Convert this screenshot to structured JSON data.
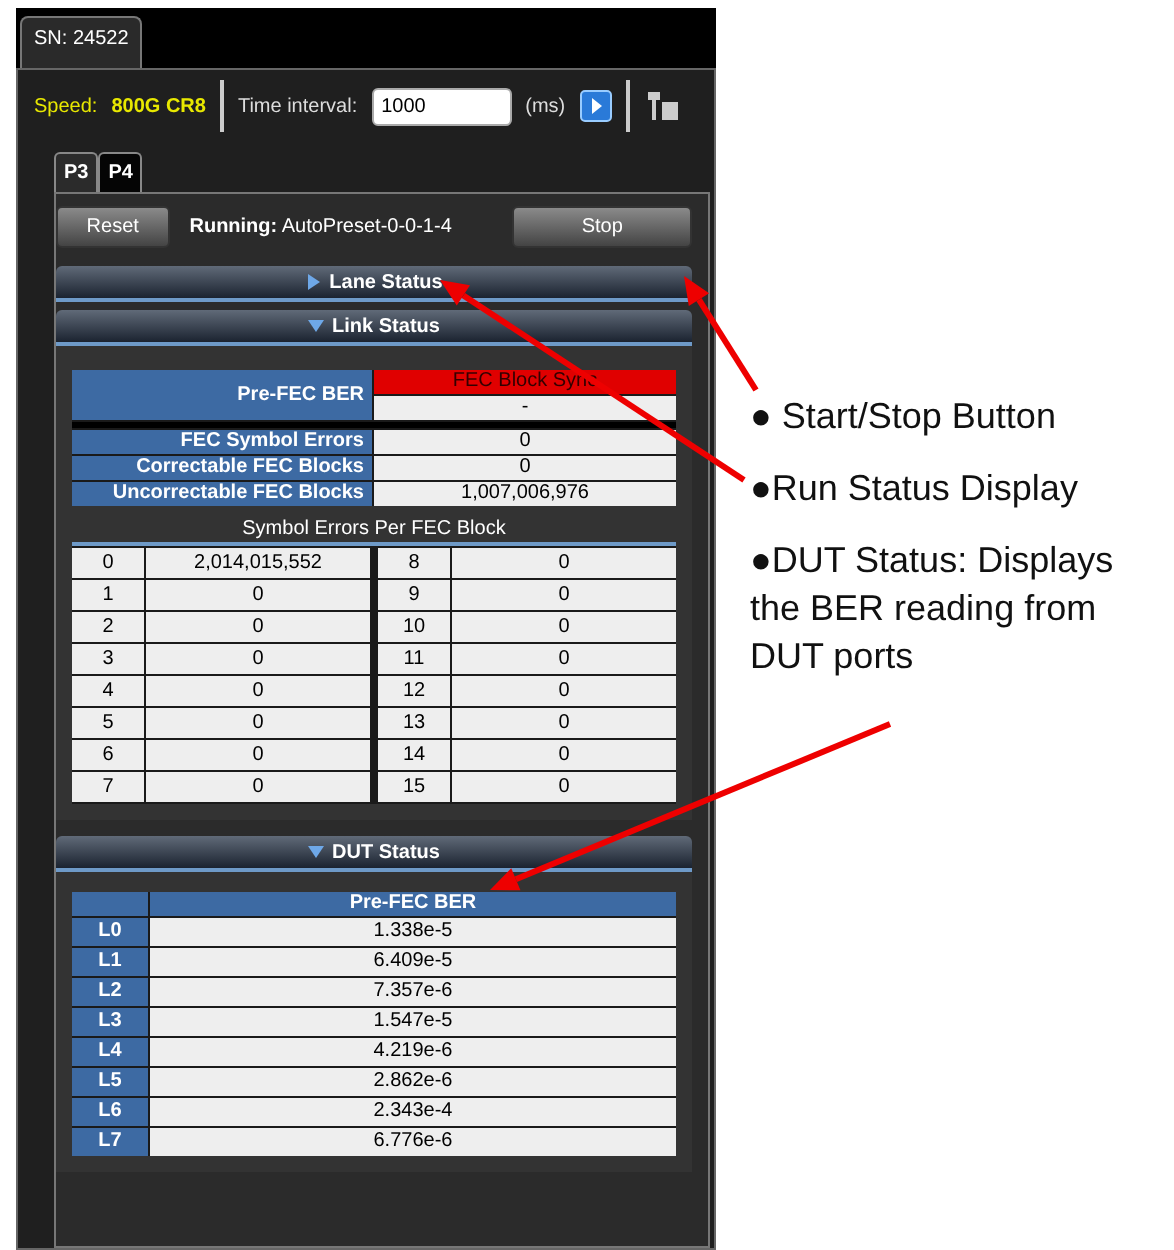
{
  "device_tab": {
    "label": "SN: 24522",
    "selected": true
  },
  "toolbar": {
    "speed_label": "Speed:",
    "speed_value": "800G CR8",
    "interval_label": "Time interval:",
    "interval_value": "1000",
    "unit": "(ms)"
  },
  "port_tabs": [
    {
      "label": "P3",
      "selected": true
    },
    {
      "label": "P4",
      "selected": false
    }
  ],
  "controls": {
    "reset": "Reset",
    "running_label": "Running:",
    "running_value": "AutoPreset-0-0-1-4",
    "stop": "Stop"
  },
  "sections": [
    {
      "title": "Lane Status",
      "expanded": false
    },
    {
      "title": "Link Status",
      "expanded": true
    }
  ],
  "link_status": {
    "ber_label": "Pre-FEC BER",
    "sync_status": "FEC Block Sync",
    "sync_ok": false,
    "ber_value": "-",
    "rows": [
      {
        "label": "FEC Symbol Errors",
        "value": "0"
      },
      {
        "label": "Correctable FEC Blocks",
        "value": "0"
      },
      {
        "label": "Uncorrectable FEC Blocks",
        "value": "1,007,006,976"
      }
    ]
  },
  "symbol_errors": {
    "title": "Symbol Errors Per FEC Block",
    "rows": [
      {
        "index": "0",
        "value": "2,014,015,552"
      },
      {
        "index": "1",
        "value": "0"
      },
      {
        "index": "2",
        "value": "0"
      },
      {
        "index": "3",
        "value": "0"
      },
      {
        "index": "4",
        "value": "0"
      },
      {
        "index": "5",
        "value": "0"
      },
      {
        "index": "6",
        "value": "0"
      },
      {
        "index": "7",
        "value": "0"
      },
      {
        "index": "8",
        "value": "0"
      },
      {
        "index": "9",
        "value": "0"
      },
      {
        "index": "10",
        "value": "0"
      },
      {
        "index": "11",
        "value": "0"
      },
      {
        "index": "12",
        "value": "0"
      },
      {
        "index": "13",
        "value": "0"
      },
      {
        "index": "14",
        "value": "0"
      },
      {
        "index": "15",
        "value": "0"
      }
    ]
  },
  "dut_status": {
    "title": "DUT Status",
    "expanded": true,
    "column": "Pre-FEC BER",
    "rows": [
      {
        "lane": "L0",
        "value": "1.338e-5"
      },
      {
        "lane": "L1",
        "value": "6.409e-5"
      },
      {
        "lane": "L2",
        "value": "7.357e-6"
      },
      {
        "lane": "L3",
        "value": "1.547e-5"
      },
      {
        "lane": "L4",
        "value": "4.219e-6"
      },
      {
        "lane": "L5",
        "value": "2.862e-6"
      },
      {
        "lane": "L6",
        "value": "2.343e-4"
      },
      {
        "lane": "L7",
        "value": "6.776e-6"
      }
    ]
  },
  "callouts": [
    "● Start/Stop Button",
    "●Run Status Display",
    "●DUT Status: Displays the BER reading from DUT ports"
  ]
}
